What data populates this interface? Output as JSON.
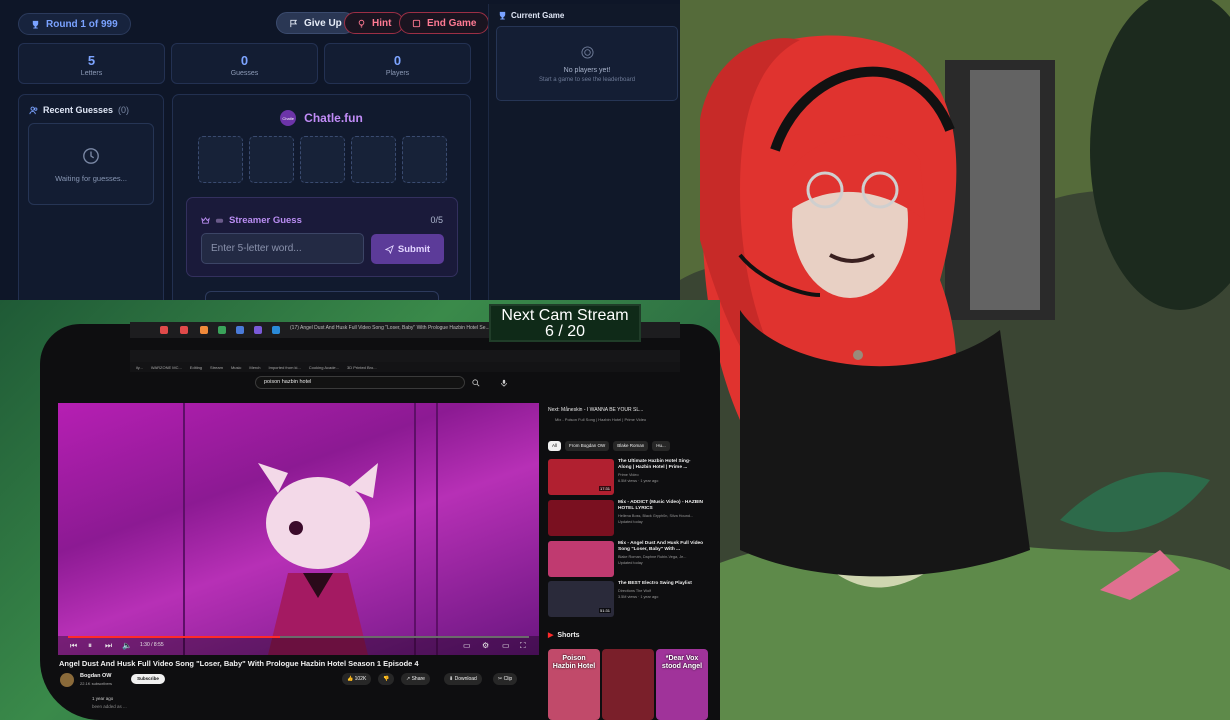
{
  "game": {
    "round": "Round 1 of 999",
    "give_up": "Give Up",
    "hint": "Hint",
    "end_game": "End Game",
    "stats": [
      {
        "value": "5",
        "label": "Letters"
      },
      {
        "value": "0",
        "label": "Guesses"
      },
      {
        "value": "0",
        "label": "Players"
      }
    ],
    "recent_title": "Recent Guesses",
    "recent_count": "(0)",
    "waiting_text": "Waiting for guesses...",
    "brand_logo_text": "Chatle",
    "brand": "Chatle.fun",
    "streamer_guess_title": "Streamer Guess",
    "streamer_guess_count": "0/5",
    "input_placeholder": "Enter 5-letter word...",
    "submit": "Submit",
    "current_game_title": "Current Game",
    "no_players": "No players yet!",
    "no_players_sub": "Start a game to see the leaderboard"
  },
  "overlay": {
    "next_cam_line1": "Next Cam Stream",
    "next_cam_line2": "6 / 20"
  },
  "browser": {
    "tab_title": "(17) Angel Dust And Husk Full Video Song \"Loser, Baby\" With Prologue Hazbin Hotel Se...",
    "search_query": "poison hazbin hotel",
    "bookmarks": [
      "ily...",
      "WARZONE MC...",
      "Editing",
      "Stream",
      "Music",
      "Merch",
      "Imported from ki...",
      "Cooking Acade...",
      "3D Printed Bro..."
    ],
    "video_time": "1:30 / 8:55",
    "progress": 0.46,
    "video_title": "Angel Dust And Husk Full Video Song \"Loser, Baby\" With Prologue Hazbin Hotel Season 1 Episode 4",
    "channel": "Bogdan OW",
    "subscribers": "22.1K subscribers",
    "subscribe": "Subscribe",
    "likes": "102K",
    "share": "Share",
    "download": "Download",
    "clip": "Clip",
    "date": "1 year ago",
    "comment_preview": "been added as ...",
    "next_up": "Next: Måneskin - I WANNA BE YOUR SL...",
    "next_up_sub": "Mix - Poison Full Song | Hazbin Hotel | Prime Video",
    "chips": [
      "All",
      "From Bogdan OW",
      "Blake Roman",
      "Hu..."
    ],
    "recommendations": [
      {
        "title": "The Ultimate Hazbin Hotel Sing-Along | Hazbin Hotel | Prime ...",
        "meta1": "Prime Video",
        "meta2": "6.5M views · 1 year ago",
        "duration": "17:31",
        "color": "#b12030"
      },
      {
        "title": "Mix - ADDICT (Music Video) - HAZBIN HOTEL LYRICS",
        "meta1": "Hellena Boss, Black Gryph0n, Silva Hound...",
        "meta2": "Updated today",
        "duration": "",
        "color": "#7a1020"
      },
      {
        "title": "Mix - Angel Dust And Husk Full Video Song \"Loser, Baby\" With ...",
        "meta1": "Blake Roman, Daphne Rubin-Vega, Je...",
        "meta2": "Updated today",
        "duration": "",
        "color": "#c03a70"
      },
      {
        "title": "The BEST Electro Swing Playlist",
        "meta1": "Directions The Wolf",
        "meta2": "3.5M views · 1 year ago",
        "duration": "51:31",
        "color": "#2a2a3a"
      }
    ],
    "shorts_title": "Shorts",
    "shorts": [
      {
        "caption": "Poison Hazbin Hotel",
        "color": "#c14a6a"
      },
      {
        "caption": "",
        "color": "#7a1f2a"
      },
      {
        "caption": "*Dear Vox stood Angel",
        "color": "#a0339a"
      }
    ]
  },
  "colors": {
    "accent_blue": "#7da4ff",
    "accent_purple": "#c18cf7",
    "danger": "#ff7a93",
    "overlay_green": "#0f2a18"
  }
}
